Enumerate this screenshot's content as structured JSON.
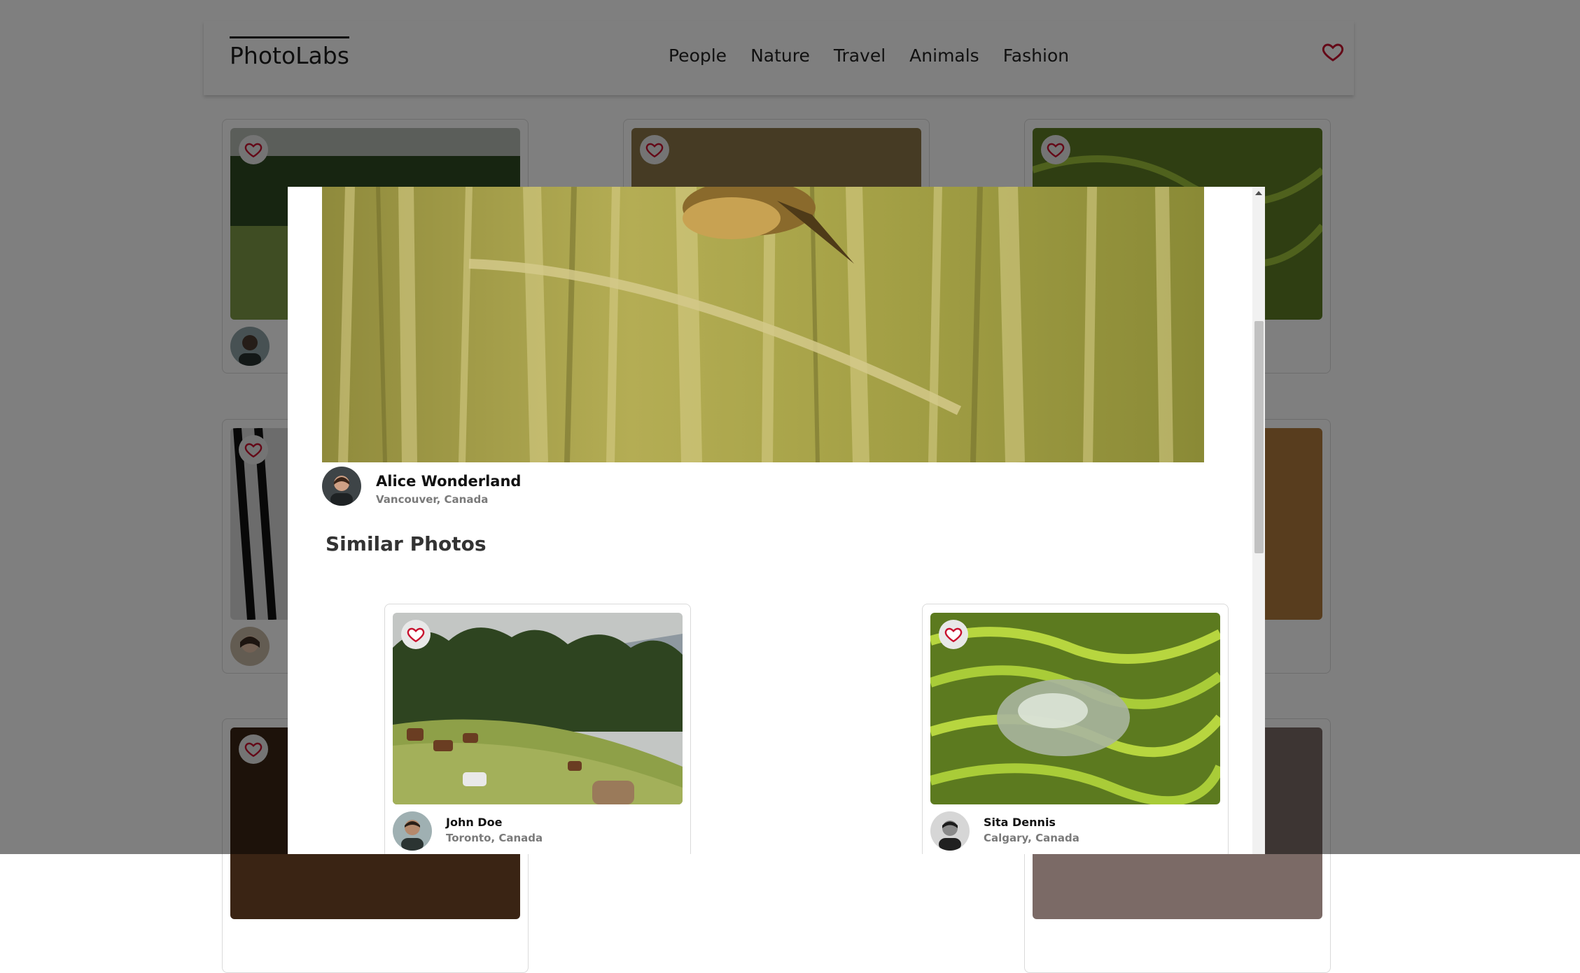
{
  "app": {
    "logo": "PhotoLabs",
    "topics": [
      "People",
      "Nature",
      "Travel",
      "Animals",
      "Fashion"
    ],
    "fav_icon": "heart-outline-icon"
  },
  "colors": {
    "accent": "#c8102e",
    "overlay": "rgba(0,0,0,0.5)",
    "muted_text": "#7a7a7a"
  },
  "modal": {
    "photographer": {
      "name": "Alice Wonderland",
      "location": "Vancouver, Canada"
    },
    "similar_title": "Similar Photos",
    "similar_photos": [
      {
        "name": "John Doe",
        "location": "Toronto, Canada"
      },
      {
        "name": "Sita Dennis",
        "location": "Calgary, Canada"
      }
    ]
  }
}
